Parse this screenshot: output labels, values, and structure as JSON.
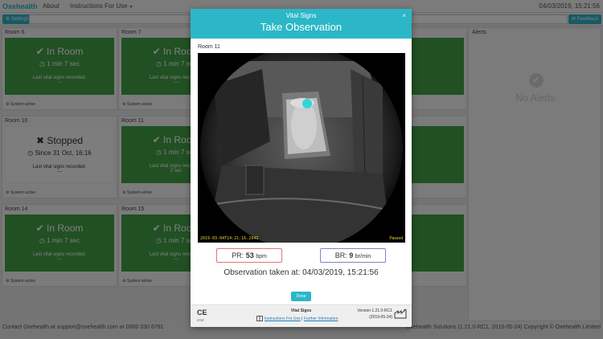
{
  "nav": {
    "brand": "Oxehealth",
    "about": "About",
    "instructions": "Instructions For Use",
    "datetime": "04/03/2019, 15:21:56",
    "settings_label": "Settings",
    "feedback_label": "Feedback"
  },
  "rooms": [
    {
      "title": "Room 6",
      "status": "In Room",
      "duration": "1 min 7 sec",
      "last_label": "Last vital signs recorded:",
      "last_value": "---",
      "system": "System active"
    },
    {
      "title": "Room 7",
      "status": "In Room",
      "duration": "1 min 7 sec",
      "last_label": "Last vital signs recorded:",
      "last_value": "---",
      "system": "System active"
    },
    {
      "title": "Room 10",
      "status": "Stopped",
      "duration": "Since 31 Oct, 16:16",
      "last_label": "Last vital signs recorded:",
      "last_value": "---",
      "system": "System active"
    },
    {
      "title": "Room 11",
      "status": "In Room",
      "duration": "1 min 7 sec",
      "last_label": "Last vital signs recorded:",
      "last_value": "2 sec",
      "system": "System active"
    },
    {
      "title": "Room 14",
      "status": "In Room",
      "duration": "1 min 7 sec",
      "last_label": "Last vital signs recorded:",
      "last_value": "---",
      "system": "System active"
    },
    {
      "title": "Room 15",
      "status": "In Room",
      "duration": "1 min 7 sec",
      "last_label": "Last vital signs recorded:",
      "last_value": "---",
      "system": "System active"
    }
  ],
  "alerts": {
    "title": "Alerts",
    "empty_text": "No Alerts"
  },
  "footer": {
    "contact": "Contact Oxehealth at support@oxehealth.com or 0800 030 6781",
    "copyright": "Oxehealth Solutions (1.21.0-RC1, 2019-05-24) Copyright © Oxehealth Limited"
  },
  "modal": {
    "subtitle": "Vital Signs",
    "title": "Take Observation",
    "room": "Room 11",
    "camera_timestamp": "2019-03-04T14:21:16.294Z",
    "camera_status": "Passed",
    "pr_label": "PR:",
    "pr_value": "53",
    "pr_unit": "bpm",
    "br_label": "BR:",
    "br_value": "9",
    "br_unit": "br/min",
    "observation_text": "Observation taken at: 04/03/2019, 15:21:56",
    "done_label": "Done",
    "close_glyph": "×"
  },
  "modal_footer": {
    "ce_mark": "CE",
    "ce_number": "2797",
    "title": "Vital Signs",
    "link_ifu": "Instructions For Use",
    "separator": "|",
    "link_further": "Further Information",
    "version": "Version 1.21.0-RC1",
    "version_date": "(2019-05-24)"
  },
  "colors": {
    "accent": "#2bb7c7",
    "status_green": "#43a047",
    "pr_border": "#e57373",
    "br_border": "#7986cb"
  }
}
